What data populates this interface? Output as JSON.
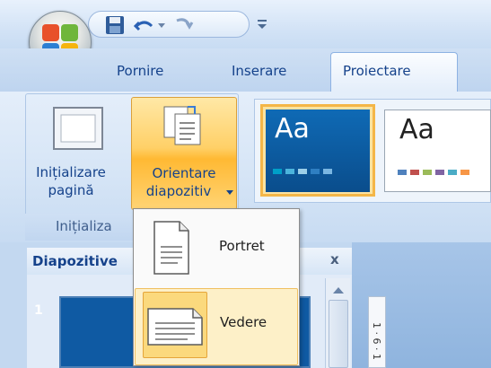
{
  "quick_access": {
    "icons": [
      "save-icon",
      "undo-icon",
      "redo-icon",
      "customize-qat-icon"
    ]
  },
  "tabs": [
    {
      "label": "Pornire"
    },
    {
      "label": "Inserare"
    },
    {
      "label": "Proiectare",
      "active": true
    }
  ],
  "ribbon": {
    "page_setup_group": {
      "label": "Inițializa",
      "page_setup_button": {
        "line1": "Inițializare",
        "line2": "pagină"
      },
      "orientation_button": {
        "line1": "Orientare",
        "line2": "diapozitiv"
      }
    },
    "themes": [
      {
        "label": "Aa",
        "swatches": [
          "#00a0c8",
          "#4cb4dc",
          "#9ccfe9",
          "#2f7fc2",
          "#7ab6e2"
        ]
      },
      {
        "label": "Aa",
        "swatches": [
          "#4f81bd",
          "#c0504d",
          "#9bbb59",
          "#8064a2",
          "#4bacc6",
          "#f79646"
        ]
      }
    ]
  },
  "orientation_menu": {
    "items": [
      {
        "label": "Portret",
        "icon": "portrait-page-icon"
      },
      {
        "label": "Vedere",
        "icon": "landscape-page-icon",
        "highlighted": true
      }
    ]
  },
  "slides_pane": {
    "tab_label": "Diapozitive",
    "close_label": "x",
    "slide_number": "1"
  },
  "ruler": {
    "label": "1 · 6 · 1"
  },
  "colors": {
    "accent_orange": "#ffc34d",
    "ribbon_text": "#15428b",
    "theme_blue": "#0f6ab5"
  }
}
